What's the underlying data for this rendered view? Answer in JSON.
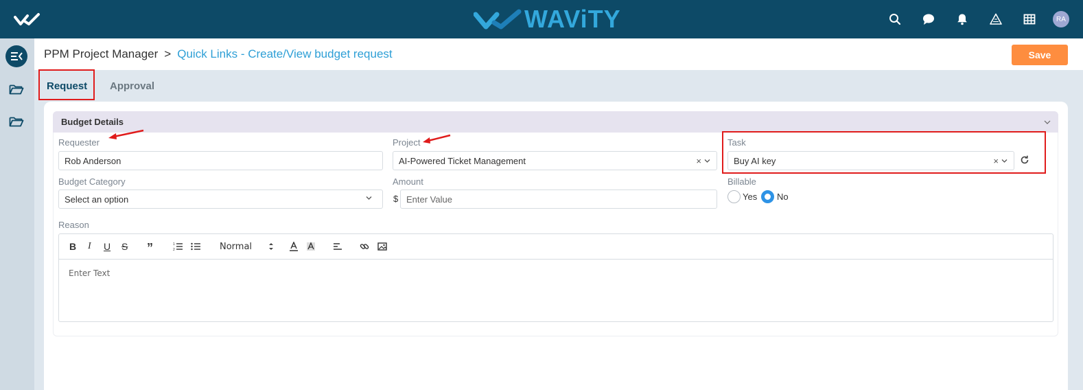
{
  "brand": {
    "name": "WAViTY"
  },
  "topbar": {
    "icons": [
      "search-icon",
      "chat-icon",
      "bell-icon",
      "warning-icon",
      "grid-icon"
    ],
    "avatar_initials": "RA"
  },
  "sidebar": {
    "icons": [
      "collapse-icon",
      "folder-icon",
      "folder-icon"
    ]
  },
  "breadcrumb": {
    "parent": "PPM Project Manager",
    "separator": ">",
    "current": "Quick Links - Create/View budget request"
  },
  "header": {
    "save_label": "Save"
  },
  "tabs": [
    {
      "label": "Request",
      "active": true
    },
    {
      "label": "Approval",
      "active": false
    }
  ],
  "section": {
    "title": "Budget Details"
  },
  "form": {
    "requester": {
      "label": "Requester",
      "value": "Rob Anderson"
    },
    "project": {
      "label": "Project",
      "value": "AI-Powered Ticket Management"
    },
    "task": {
      "label": "Task",
      "value": "Buy AI key"
    },
    "budget_category": {
      "label": "Budget Category",
      "value": "Select an option"
    },
    "amount": {
      "label": "Amount",
      "currency": "$",
      "placeholder": "Enter Value"
    },
    "billable": {
      "label": "Billable",
      "options": [
        "Yes",
        "No"
      ],
      "selected": "No"
    },
    "reason": {
      "label": "Reason",
      "placeholder": "Enter Text",
      "format_select": "Normal"
    }
  },
  "colors": {
    "topbar": "#0d4a67",
    "accent": "#2e9fd6",
    "save": "#fe8d3f",
    "highlight": "#e01b1b",
    "section_header": "#e6e3ef"
  }
}
